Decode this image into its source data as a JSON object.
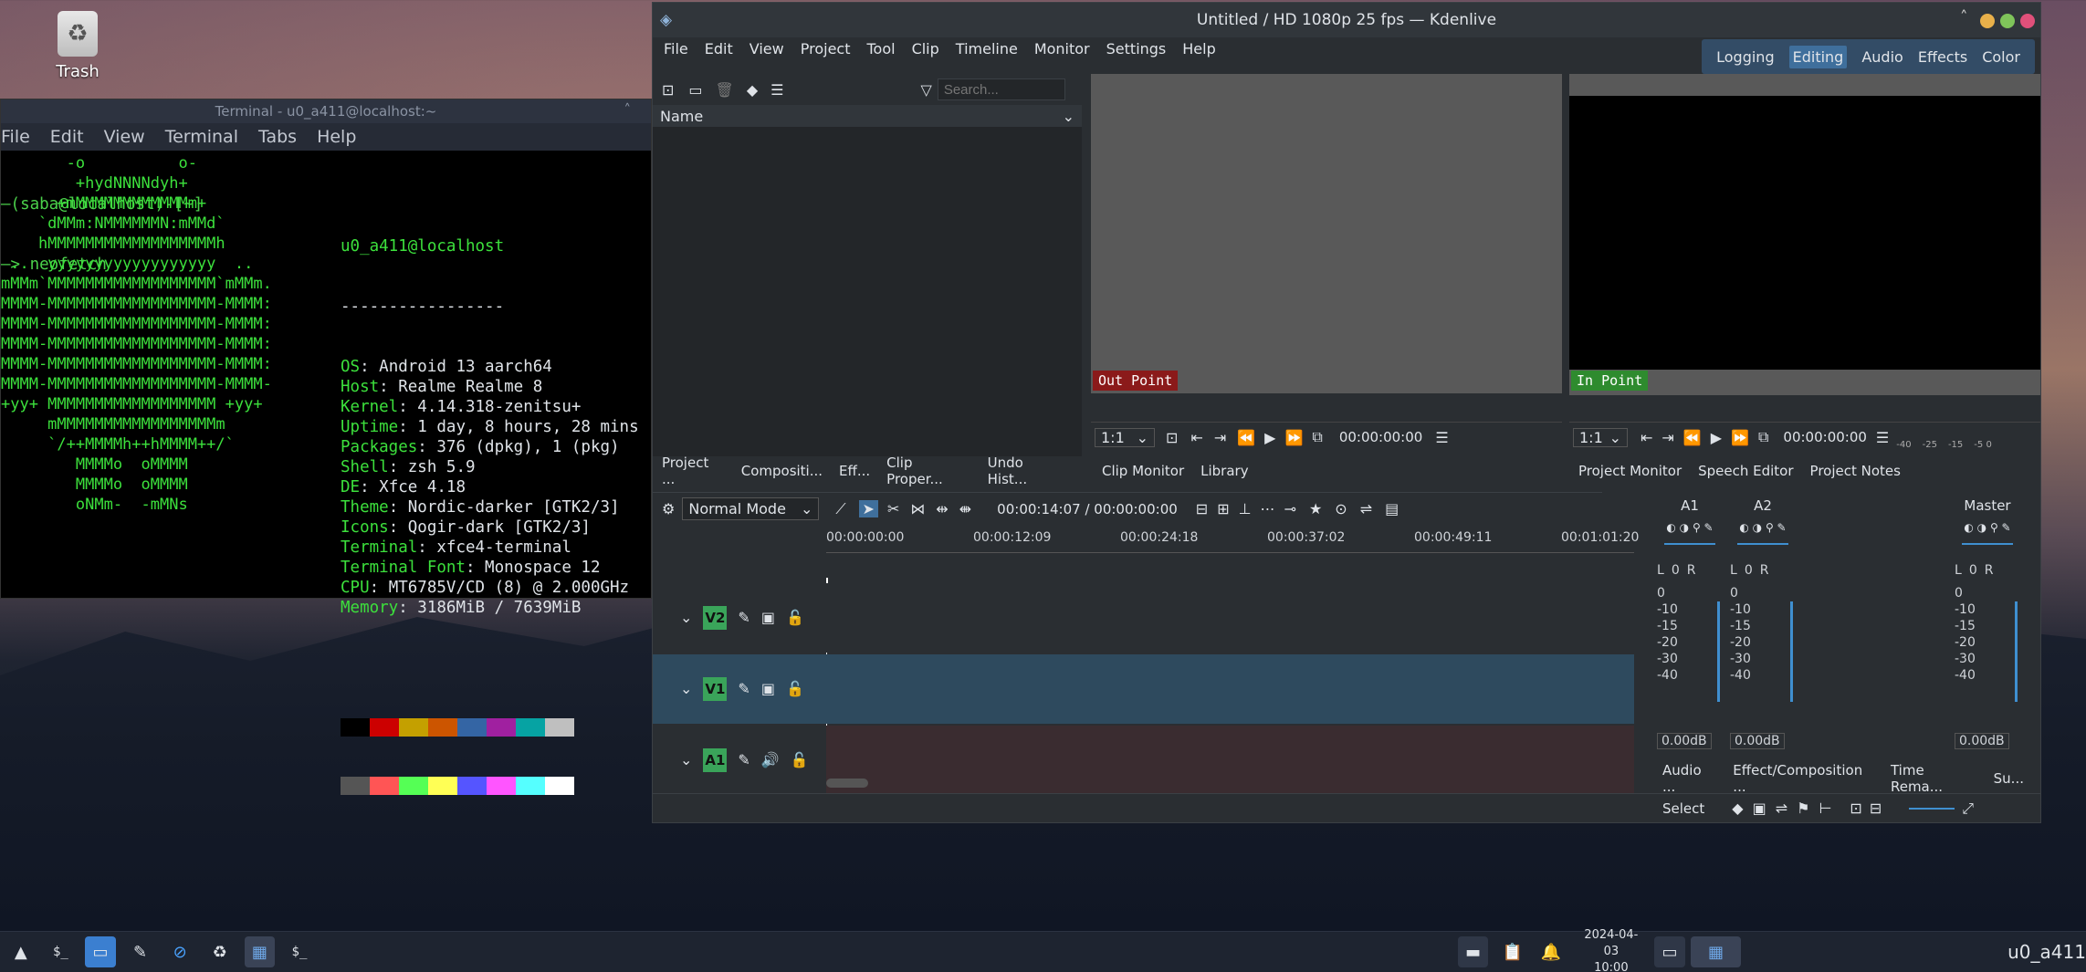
{
  "desktop": {
    "trash_label": "Trash"
  },
  "terminal": {
    "title": "Terminal - u0_a411@localhost:~",
    "menu": [
      "File",
      "Edit",
      "View",
      "Terminal",
      "Tabs",
      "Help"
    ],
    "prompt_line": "—(saba@localhost)-[~]",
    "command_line": "—> neofetch",
    "logo_lines": [
      "       -o          o-",
      "        +hydNNNNdyh+",
      "      +mMMMMMMMMMMMMm+",
      "    `dMMm:NMMMMMMN:mMMd`",
      "    hMMMMMMMMMMMMMMMMMMh",
      " ..  yyyyyyyyyyyyyyyyyy  ..",
      "mMMm`MMMMMMMMMMMMMMMMMM`mMMm.",
      "MMMM-MMMMMMMMMMMMMMMMMM-MMMM:",
      "MMMM-MMMMMMMMMMMMMMMMMM-MMMM:",
      "MMMM-MMMMMMMMMMMMMMMMMM-MMMM:",
      "MMMM-MMMMMMMMMMMMMMMMMM-MMMM:",
      "MMMM-MMMMMMMMMMMMMMMMMM-MMMM-",
      "+yy+ MMMMMMMMMMMMMMMMMM +yy+",
      "     mMMMMMMMMMMMMMMMMMm",
      "     `/++MMMMh++hMMMM++/`",
      "        MMMMo  oMMMM",
      "        MMMMo  oMMMM",
      "        oNMm-  -mMNs"
    ],
    "userhost": "u0_a411@localhost",
    "separator": "-----------------",
    "info": [
      {
        "k": "OS",
        "v": " Android 13 aarch64"
      },
      {
        "k": "Host",
        "v": " Realme Realme 8"
      },
      {
        "k": "Kernel",
        "v": " 4.14.318-zenitsu+"
      },
      {
        "k": "Uptime",
        "v": " 1 day, 8 hours, 28 mins"
      },
      {
        "k": "Packages",
        "v": " 376 (dpkg), 1 (pkg)"
      },
      {
        "k": "Shell",
        "v": " zsh 5.9"
      },
      {
        "k": "DE",
        "v": " Xfce 4.18"
      },
      {
        "k": "Theme",
        "v": " Nordic-darker [GTK2/3]"
      },
      {
        "k": "Icons",
        "v": " Qogir-dark [GTK2/3]"
      },
      {
        "k": "Terminal",
        "v": " xfce4-terminal"
      },
      {
        "k": "Terminal Font",
        "v": " Monospace 12"
      },
      {
        "k": "CPU",
        "v": " MT6785V/CD (8) @ 2.000GHz"
      },
      {
        "k": "Memory",
        "v": " 3186MiB / 7639MiB"
      }
    ],
    "palette_top": [
      "#000000",
      "#cc0000",
      "#c4a000",
      "#cc5500",
      "#3465a4",
      "#a020a0",
      "#06a3a3",
      "#bfbfbf"
    ],
    "palette_bottom": [
      "#555555",
      "#ff5555",
      "#55ff55",
      "#ffff55",
      "#5555ff",
      "#ff55ff",
      "#55ffff",
      "#ffffff"
    ]
  },
  "kdenlive": {
    "title": "Untitled / HD 1080p 25 fps — Kdenlive",
    "menu": [
      "File",
      "Edit",
      "View",
      "Project",
      "Tool",
      "Clip",
      "Timeline",
      "Monitor",
      "Settings",
      "Help"
    ],
    "workspaces": [
      "Logging",
      "Editing",
      "Audio",
      "Effects",
      "Color"
    ],
    "active_workspace": "Editing",
    "bin_search_placeholder": "Search...",
    "bin_column": "Name",
    "bin_tabs": [
      "Project ...",
      "Compositi...",
      "Eff...",
      "Clip Proper...",
      "Undo Hist..."
    ],
    "clip_monitor": {
      "marker": "Out Point",
      "zoom": "1:1",
      "timecode": "00:00:00:00",
      "tabs": [
        "Clip Monitor",
        "Library"
      ]
    },
    "project_monitor": {
      "marker": "In Point",
      "zoom": "1:1",
      "timecode": "00:00:00:00",
      "tabs": [
        "Project Monitor",
        "Speech Editor",
        "Project Notes"
      ],
      "meter_labels": [
        "-40",
        "-25",
        "-15",
        "-5 0"
      ]
    },
    "timeline": {
      "mode": "Normal Mode",
      "position": "00:00:14:07 / 00:00:00:00",
      "ruler": [
        "00:00:00:00",
        "00:00:12:09",
        "00:00:24:18",
        "00:00:37:02",
        "00:00:49:11",
        "00:01:01:20"
      ],
      "master_label": "Master",
      "tracks": [
        {
          "name": "V2",
          "type": "video"
        },
        {
          "name": "V1",
          "type": "video"
        },
        {
          "name": "A1",
          "type": "audio"
        }
      ]
    },
    "mixer": {
      "channels": [
        "A1",
        "A2"
      ],
      "master": "Master",
      "L": "L",
      "R": "R",
      "level_zero": "0",
      "scale": [
        "0",
        "-10",
        "-15",
        "-20",
        "-30",
        "-40"
      ],
      "gain": "0.00dB"
    },
    "bottom_tabs": [
      "Audio ...",
      "Effect/Composition ...",
      "Time Rema...",
      "Su..."
    ],
    "status_select": "Select"
  },
  "taskbar": {
    "date": "2024-04-03",
    "time": "10:00",
    "user": "u0_a411"
  }
}
